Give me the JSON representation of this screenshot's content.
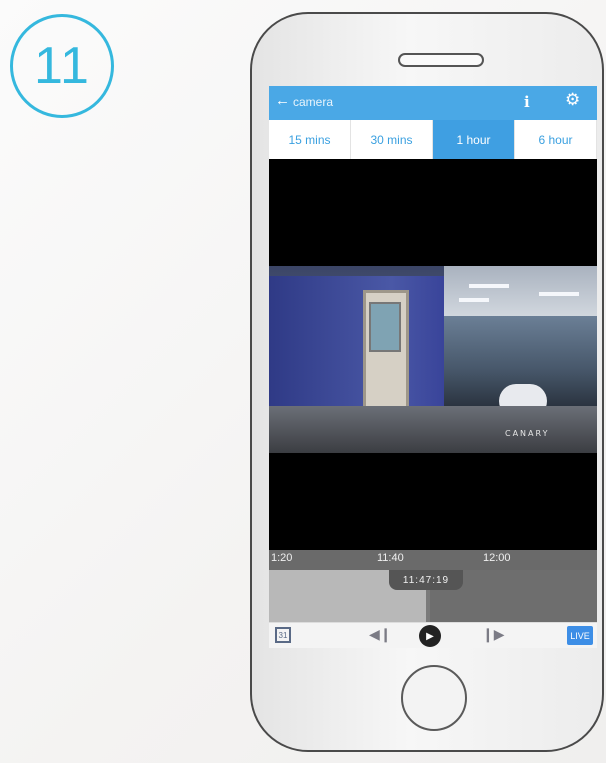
{
  "step": {
    "number": "11"
  },
  "app": {
    "back_icon": "arrow-left-icon",
    "title": "camera",
    "info_icon": "info-icon",
    "settings_icon": "gear-icon"
  },
  "tabs": [
    {
      "label": "15 mins",
      "active": false
    },
    {
      "label": "30 mins",
      "active": false
    },
    {
      "label": "1 hour",
      "active": true
    },
    {
      "label": "6 hour",
      "active": false
    }
  ],
  "video": {
    "watermark": "CANARY"
  },
  "timeline": {
    "ticks": [
      "1:20",
      "11:40",
      "12:00"
    ],
    "current_time": "11:47:19"
  },
  "controls": {
    "calendar_icon": "calendar-icon",
    "prev_icon": "skip-previous-icon",
    "play_icon": "play-icon",
    "next_icon": "skip-next-icon",
    "live_label": "LIVE"
  },
  "colors": {
    "accent": "#4aa8e6",
    "badge": "#35b8de"
  }
}
